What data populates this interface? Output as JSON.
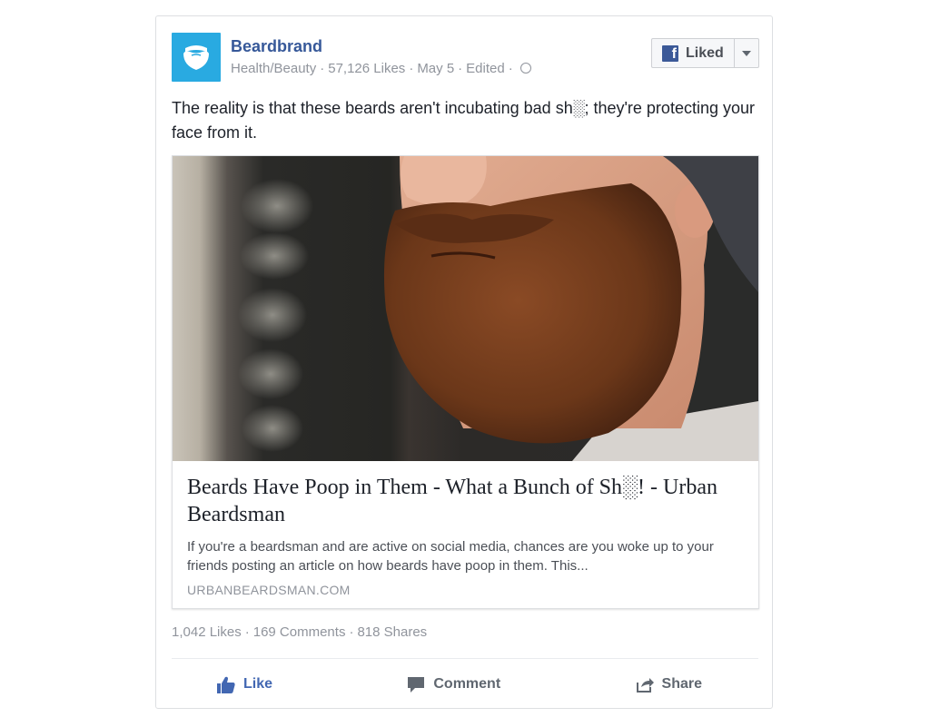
{
  "post": {
    "page_name": "Beardbrand",
    "category": "Health/Beauty",
    "likes_label": "57,126 Likes",
    "date": "May 5",
    "edited_label": "Edited",
    "liked_button_label": "Liked",
    "text": "The reality is that these beards aren't incubating bad sh░; they're protecting your face from it."
  },
  "link": {
    "title": "Beards Have Poop in Them - What a Bunch of Sh░! - Urban Beardsman",
    "description": "If you're a beardsman and are active on social media, chances are you woke up to your friends posting an article on how beards have poop in them. This...",
    "domain": "URBANBEARDSMAN.COM"
  },
  "stats": {
    "likes": "1,042 Likes",
    "comments": "169 Comments",
    "shares": "818 Shares"
  },
  "actions": {
    "like": "Like",
    "comment": "Comment",
    "share": "Share"
  },
  "icons": {
    "avatar": "beard-logo-icon",
    "privacy": "globe-icon",
    "page_badge": "facebook-logo-icon",
    "dropdown": "chevron-down-icon",
    "like": "thumbs-up-icon",
    "comment": "comment-icon",
    "share": "share-icon"
  },
  "colors": {
    "brand_blue": "#365899",
    "like_blue": "#4267b2",
    "avatar_bg": "#29aae1",
    "muted_text": "#90949c"
  }
}
